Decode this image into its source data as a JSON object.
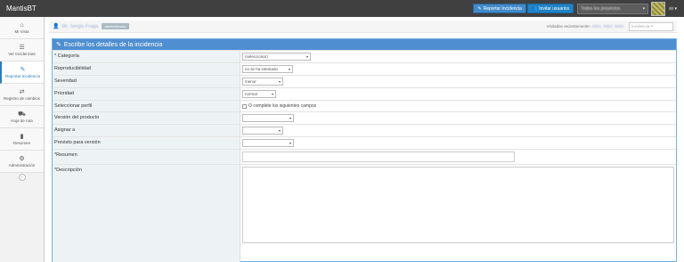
{
  "app": {
    "brand": "MantisBT"
  },
  "navbar": {
    "report_button": "Reportar Incidencia",
    "invite_button": "Invitar usuarios",
    "project_selector": "Todos los proyectos",
    "user_menu": "xx"
  },
  "sidebar": {
    "items": [
      {
        "label": "Mi Vista",
        "icon": "dashboard-icon",
        "glyph": "⌂"
      },
      {
        "label": "Ver Incidencias",
        "icon": "list-icon",
        "glyph": "☰"
      },
      {
        "label": "Reportar Incidencia",
        "icon": "edit-icon",
        "glyph": "✎"
      },
      {
        "label": "Registro de cambios",
        "icon": "retweet-icon",
        "glyph": "⇄"
      },
      {
        "label": "Hoja de ruta",
        "icon": "road-icon",
        "glyph": "⛟"
      },
      {
        "label": "Resumen",
        "icon": "bar-chart-icon",
        "glyph": "▮"
      },
      {
        "label": "Administración",
        "icon": "gears-icon",
        "glyph": "⚙"
      }
    ],
    "collapse_glyph": "‹"
  },
  "breadcrumb": {
    "user_name": "Mr. Sergio Fraga",
    "role_badge": "administrador",
    "recent_label": "Visitadas recientemente:",
    "recent_links": "0001, 0002, 0003",
    "search_placeholder": "Incidencia #"
  },
  "form": {
    "title": "Escribe los detalles de la incidencia",
    "fields": {
      "category": {
        "label": "* Categoría",
        "value": "(seleccionar)"
      },
      "reproducibility": {
        "label": "Reproducibilidad",
        "value": "no se ha intentado"
      },
      "severity": {
        "label": "Severidad",
        "value": "menor"
      },
      "priority": {
        "label": "Prioridad",
        "value": "normal"
      },
      "profile": {
        "label": "Seleccionar perfil",
        "value": "O complete los siguientes campos"
      },
      "product_version": {
        "label": "Versión del producto",
        "value": ""
      },
      "assign_to": {
        "label": "Asignar a",
        "value": ""
      },
      "target_version": {
        "label": "Previsto para versión",
        "value": ""
      },
      "summary": {
        "label": "*Resumen",
        "value": ""
      },
      "description": {
        "label": "*Descripción",
        "value": ""
      }
    }
  },
  "colors": {
    "navbar": "#404040",
    "header": "#4f8ed0",
    "label_bg": "#edf3f4",
    "accent": "#2b7dbc"
  }
}
